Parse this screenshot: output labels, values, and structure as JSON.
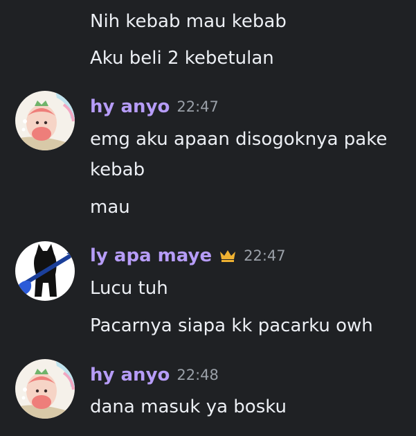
{
  "messages": {
    "continuation_1": "Nih kebab mau kebab",
    "continuation_2": "Aku beli 2 kebetulan"
  },
  "groups": [
    {
      "username": "hy anyo",
      "timestamp": "22:47",
      "lines": [
        "emg aku apaan disogoknya pake",
        "kebab",
        "mau"
      ],
      "avatar": "strawberry-character-avatar"
    },
    {
      "username": "ly apa maye",
      "timestamp": "22:47",
      "badge": "crown-icon",
      "lines": [
        "Lucu tuh",
        "Pacarnya siapa kk pacarku owh"
      ],
      "avatar": "cat-with-guitar-avatar"
    },
    {
      "username": "hy anyo",
      "timestamp": "22:48",
      "lines": [
        "dana masuk ya bosku"
      ],
      "avatar": "strawberry-character-avatar"
    }
  ],
  "colors": {
    "background": "#1f2124",
    "username": "#b69cf7",
    "timestamp": "#9aa0a8",
    "text": "#eceff4",
    "crown": "#f0b232"
  }
}
